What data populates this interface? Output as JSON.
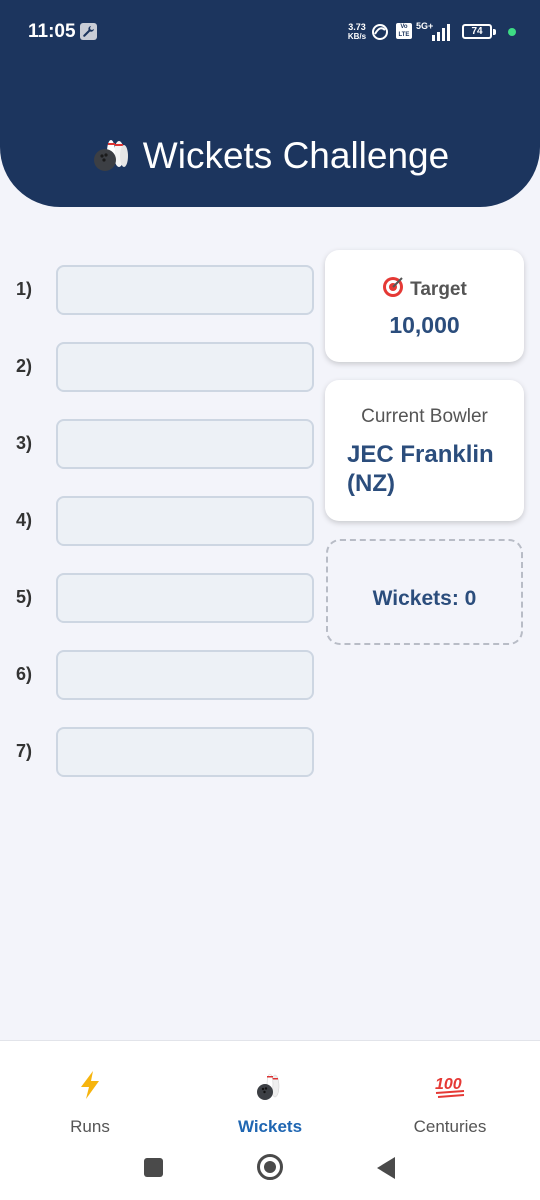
{
  "status_bar": {
    "time": "11:05",
    "net_speed_value": "3.73",
    "net_speed_unit": "KB/s",
    "volte": "Vo LTE",
    "network": "5G+",
    "battery": "74"
  },
  "header": {
    "title": "Wickets Challenge",
    "icon": "bowling-icon"
  },
  "wicket_inputs": [
    {
      "label": "1)",
      "value": ""
    },
    {
      "label": "2)",
      "value": ""
    },
    {
      "label": "3)",
      "value": ""
    },
    {
      "label": "4)",
      "value": ""
    },
    {
      "label": "5)",
      "value": ""
    },
    {
      "label": "6)",
      "value": ""
    },
    {
      "label": "7)",
      "value": ""
    }
  ],
  "target": {
    "icon": "target-icon",
    "label": "Target",
    "value": "10,000"
  },
  "bowler": {
    "label": "Current Bowler",
    "name": "JEC Franklin (NZ)"
  },
  "wickets": {
    "text": "Wickets: 0"
  },
  "bottom_nav": {
    "items": [
      {
        "label": "Runs",
        "icon": "lightning-icon",
        "active": false
      },
      {
        "label": "Wickets",
        "icon": "bowling-icon",
        "active": true
      },
      {
        "label": "Centuries",
        "icon": "hundred-icon",
        "active": false
      }
    ]
  },
  "colors": {
    "header_bg": "#1c355e",
    "accent_text": "#2b4d7c",
    "active_nav": "#1f66b2",
    "page_bg": "#f3f4fa"
  }
}
